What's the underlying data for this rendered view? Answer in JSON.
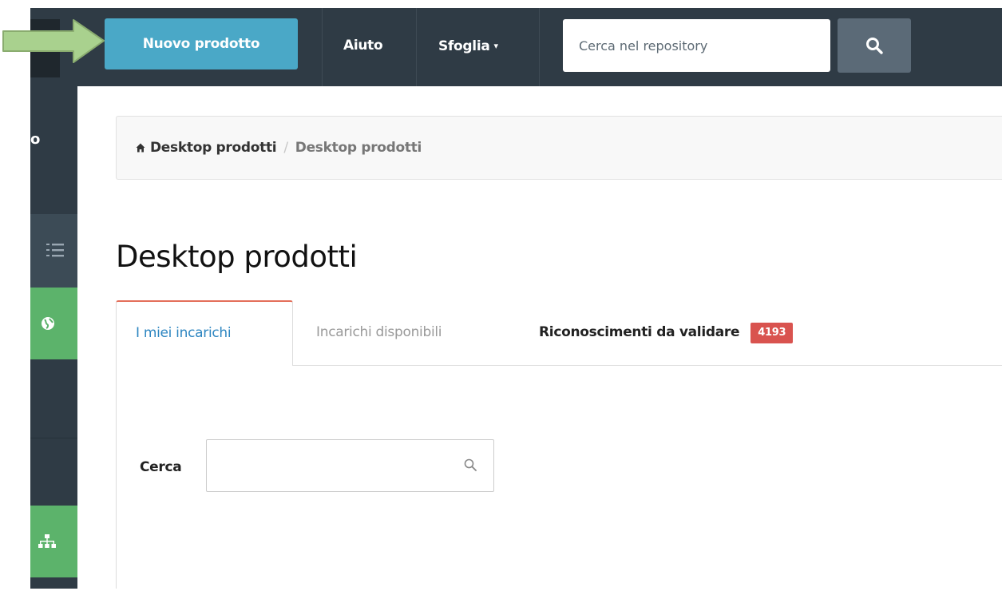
{
  "topbar": {
    "new_product_label": "Nuovo prodotto",
    "help_label": "Aiuto",
    "browse_label": "Sfoglia",
    "browse_caret": "▾",
    "search_placeholder": "Cerca nel repository",
    "search_icon": "search-icon"
  },
  "sidebar": {
    "partial_letter": "o",
    "icons": [
      "list-icon",
      "globe-icon",
      "sitemap-icon"
    ]
  },
  "breadcrumb": {
    "home_icon": "home-icon",
    "home_label": "Desktop prodotti",
    "separator": "/",
    "current_label": "Desktop prodotti"
  },
  "page": {
    "title": "Desktop prodotti"
  },
  "tabs": [
    {
      "label": "I miei incarichi",
      "active": true
    },
    {
      "label": "Incarichi disponibili",
      "active": false
    },
    {
      "label": "Riconoscimenti da validare",
      "badge": "4193",
      "active": false
    }
  ],
  "filter": {
    "search_label": "Cerca",
    "search_value": "",
    "search_icon": "search-icon"
  },
  "colors": {
    "topbar": "#2f3b45",
    "primary_button": "#4aa8c7",
    "sidebar_active": "#5cb36b",
    "badge": "#d9534f",
    "active_tab_text": "#2e86c1",
    "annotation_arrow": "#a9d18e"
  }
}
